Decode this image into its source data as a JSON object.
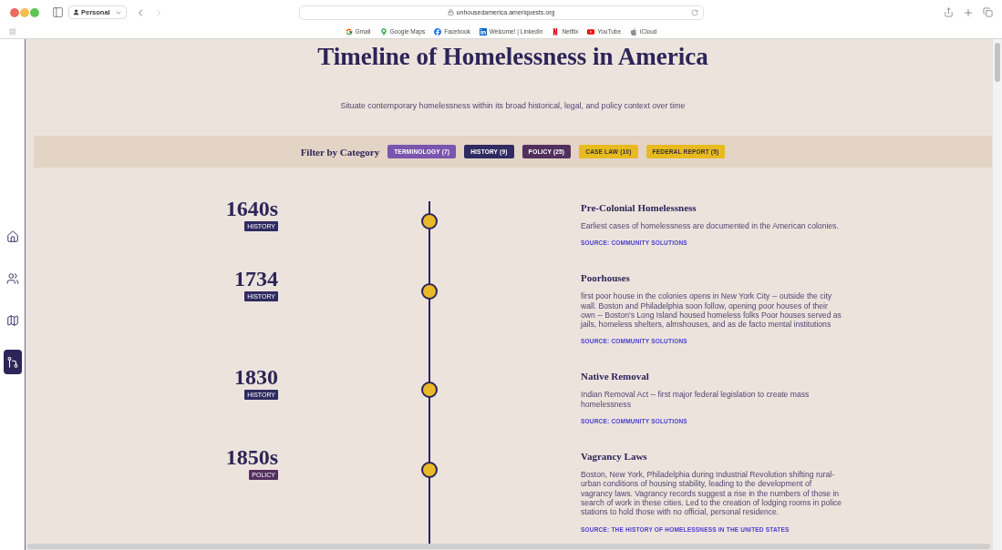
{
  "browser": {
    "profile": "Personal",
    "back_disabled": false,
    "forward_disabled": true,
    "url": "unhousedamerica.ameriquests.org",
    "bookmarks": [
      {
        "kind": "gmail",
        "label": "Gmail"
      },
      {
        "kind": "maps",
        "label": "Google Maps"
      },
      {
        "kind": "facebook",
        "label": "Facebook"
      },
      {
        "kind": "linkedin",
        "label": "Welcome! | LinkedIn"
      },
      {
        "kind": "netflix",
        "label": "Netflix"
      },
      {
        "kind": "youtube",
        "label": "YouTube"
      },
      {
        "kind": "apple",
        "label": "iCloud"
      }
    ]
  },
  "sidebar": {
    "items": [
      {
        "kind": "home",
        "selected": false
      },
      {
        "kind": "people",
        "selected": false
      },
      {
        "kind": "map",
        "selected": false
      },
      {
        "kind": "timeline",
        "selected": true
      }
    ]
  },
  "header": {
    "title": "Timeline of Homelessness in America",
    "subtitle": "Situate contemporary homelessness within its broad historical, legal, and policy context over time"
  },
  "filter": {
    "label": "Filter by Category",
    "categories": [
      {
        "label": "TERMINOLOGY (7)",
        "color": "#7a55ae"
      },
      {
        "label": "HISTORY (9)",
        "color": "#2f2a60"
      },
      {
        "label": "POLICY (25)",
        "color": "#52305e"
      },
      {
        "label": "CASE LAW (10)",
        "color": "#e7bb1f"
      },
      {
        "label": "FEDERAL REPORT (5)",
        "color": "#e7bb1f"
      }
    ]
  },
  "timeline": {
    "events": [
      {
        "year": "1640s",
        "category": {
          "label": "HISTORY",
          "color": "#2f2a60"
        },
        "title": "Pre-Colonial Homelessness",
        "description": "Earliest cases of homelessness are documented in the American colonies.",
        "source": "SOURCE: COMMUNITY SOLUTIONS"
      },
      {
        "year": "1734",
        "category": {
          "label": "HISTORY",
          "color": "#2f2a60"
        },
        "title": "Poorhouses",
        "description": "first poor house in the colonies opens in New York City -- outside the city wall. Boston and Philadelphia soon follow, opening poor houses of their own -- Boston's Long Island housed homeless folks Poor houses served as jails, homeless shelters, almshouses, and as de facto mental institutions",
        "source": "SOURCE: COMMUNITY SOLUTIONS"
      },
      {
        "year": "1830",
        "category": {
          "label": "HISTORY",
          "color": "#2f2a60"
        },
        "title": "Native Removal",
        "description": "Indian Removal Act -- first major federal legislation to create mass homelessness",
        "source": "SOURCE: COMMUNITY SOLUTIONS"
      },
      {
        "year": "1850s",
        "category": {
          "label": "POLICY",
          "color": "#52305e"
        },
        "title": "Vagrancy Laws",
        "description": "Boston, New York, Philadelphia during Industrial Revolution shifting rural-urban conditions of housing stability, leading to the development of vagrancy laws. Vagrancy records suggest a rise in the numbers of those in search of work in these cities. Led to the creation of lodging rooms in police stations to hold those with no official, personal residence.",
        "source": "SOURCE: THE HISTORY OF HOMELESSNESS IN THE UNITED STATES"
      }
    ]
  }
}
